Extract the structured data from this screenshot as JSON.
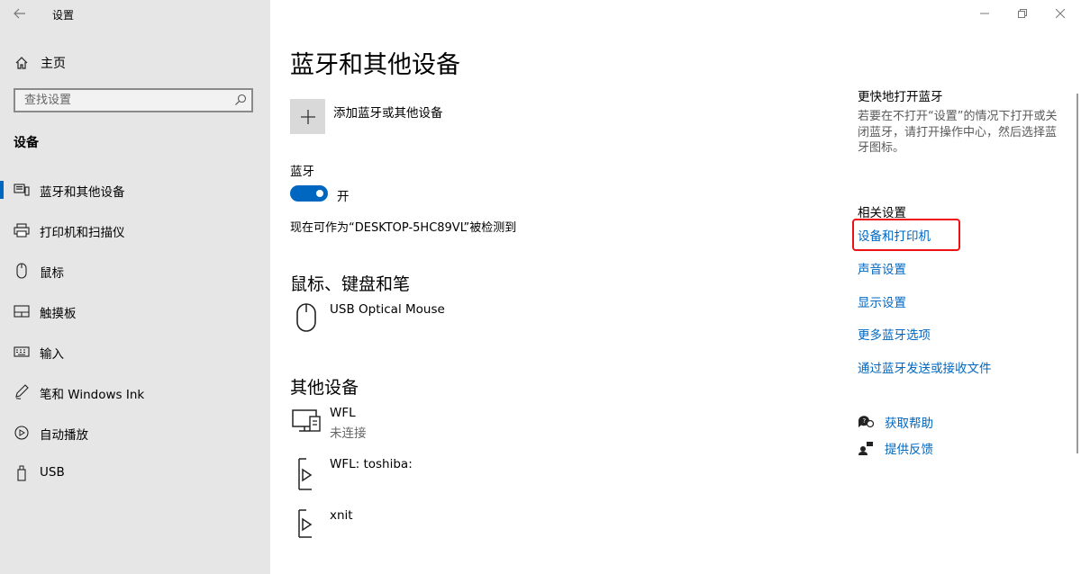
{
  "window": {
    "title": "设置"
  },
  "sidebar": {
    "home_label": "主页",
    "search_placeholder": "查找设置",
    "section_label": "设备",
    "items": [
      {
        "label": "蓝牙和其他设备",
        "icon": "bluetooth-devices-icon",
        "active": true
      },
      {
        "label": "打印机和扫描仪",
        "icon": "printer-icon",
        "active": false
      },
      {
        "label": "鼠标",
        "icon": "mouse-icon",
        "active": false
      },
      {
        "label": "触摸板",
        "icon": "touchpad-icon",
        "active": false
      },
      {
        "label": "输入",
        "icon": "keyboard-icon",
        "active": false
      },
      {
        "label": "笔和 Windows Ink",
        "icon": "pen-icon",
        "active": false
      },
      {
        "label": "自动播放",
        "icon": "autoplay-icon",
        "active": false
      },
      {
        "label": "USB",
        "icon": "usb-icon",
        "active": false
      }
    ]
  },
  "main": {
    "title": "蓝牙和其他设备",
    "add_device_label": "添加蓝牙或其他设备",
    "bluetooth_label": "蓝牙",
    "bluetooth_state": "开",
    "discoverable_text": "现在可作为“DESKTOP-5HC89VL”被检测到",
    "mouse_section_title": "鼠标、键盘和笔",
    "mouse_devices": [
      {
        "name": "USB Optical Mouse",
        "status": "",
        "icon": "mouse-device-icon"
      }
    ],
    "other_section_title": "其他设备",
    "other_devices": [
      {
        "name": "WFL",
        "status": "未连接",
        "icon": "network-device-icon"
      },
      {
        "name": "WFL: toshiba:",
        "status": "",
        "icon": "media-device-icon"
      },
      {
        "name": "xnit",
        "status": "",
        "icon": "media-device-icon"
      }
    ]
  },
  "related": {
    "quick_title": "更快地打开蓝牙",
    "quick_desc": "若要在不打开“设置”的情况下打开或关闭蓝牙，请打开操作中心，然后选择蓝牙图标。",
    "related_title": "相关设置",
    "links": [
      "设备和打印机",
      "声音设置",
      "显示设置",
      "更多蓝牙选项",
      "通过蓝牙发送或接收文件"
    ],
    "get_help": "获取帮助",
    "give_feedback": "提供反馈"
  },
  "colors": {
    "accent": "#0067c0",
    "sidebar_bg": "#e6e6e6",
    "highlight": "#ee1111"
  }
}
